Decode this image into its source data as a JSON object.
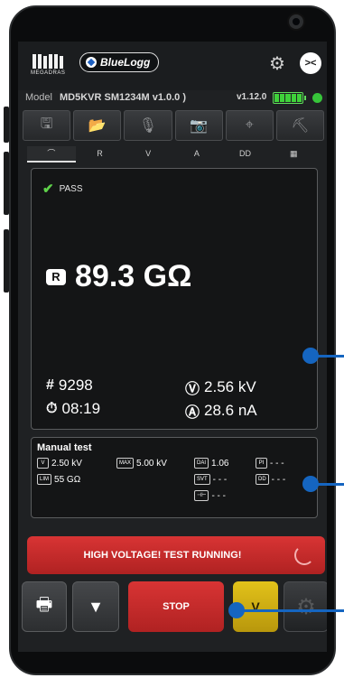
{
  "header": {
    "brand_sub": "MEGADRAS",
    "app_name": "BlueLogg",
    "settings_icon": "gear-icon",
    "connection_icon": "bluetooth-link-icon"
  },
  "device": {
    "model_label": "Model",
    "model_value": "MD5KVR SM1234M  v1.0.0 )",
    "version": "v1.12.0",
    "battery_level": 1.0,
    "bluetooth_status_color": "#37c53a"
  },
  "toolbar": {
    "items": [
      {
        "name": "save",
        "glyph": "🖫"
      },
      {
        "name": "open-folder",
        "glyph": "📂"
      },
      {
        "name": "microphone",
        "glyph": "🎙"
      },
      {
        "name": "camera",
        "glyph": "📷"
      },
      {
        "name": "gps",
        "glyph": "⌖"
      },
      {
        "name": "map",
        "glyph": "⛏"
      }
    ]
  },
  "subtabs": [
    "⌒",
    "R",
    "V",
    "A",
    "DD",
    "▦"
  ],
  "main": {
    "status": "PASS",
    "reading_badge": "R",
    "reading_value": "89.3 GΩ",
    "count_symbol": "#",
    "count_value": "9298",
    "time_symbol": "⏱",
    "time_value": "08:19",
    "voltage_symbol": "Ⓥ",
    "voltage_value": "2.56 kV",
    "current_symbol": "Ⓐ",
    "current_value": "28.6 nA"
  },
  "manual_test": {
    "title": "Manual test",
    "items": [
      {
        "tag": "V",
        "value": "2.50 kV"
      },
      {
        "tag": "MAX",
        "value": "5.00 kV"
      },
      {
        "tag": "DAI",
        "value": "1.06"
      },
      {
        "tag": "PI",
        "value": "- - -"
      },
      {
        "tag": "LIM",
        "value": "55 GΩ"
      },
      {
        "tag": "SVT",
        "value": "- - -"
      },
      {
        "tag": "DD",
        "value": "- - -"
      },
      {
        "tag": "⊣⊢",
        "value": "- - -"
      }
    ]
  },
  "warning": {
    "text": "HIGH VOLTAGE! TEST RUNNING!"
  },
  "bottom": {
    "print_icon": "printer-icon",
    "filter_icon": "filter-icon",
    "stop_label": "STOP",
    "v_label": "V",
    "settings_icon": "gear-icon"
  },
  "colors": {
    "accent_red": "#c82a2a",
    "accent_yellow": "#d4b212",
    "pass_green": "#5fd24a",
    "callout_blue": "#1565c0"
  }
}
